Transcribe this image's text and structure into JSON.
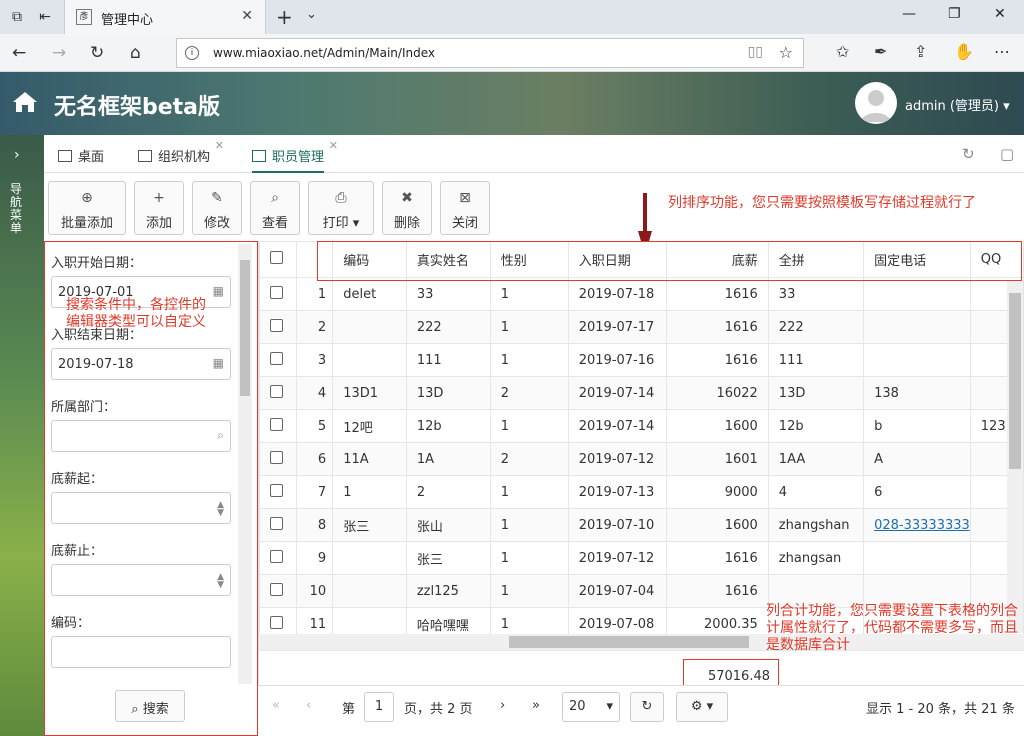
{
  "browser": {
    "tab_title": "管理中心",
    "tab_favicon_text": "彥",
    "url": "www.miaoxiao.net/Admin/Main/Index"
  },
  "header": {
    "brand": "无名框架beta版",
    "user": "admin (管理员)"
  },
  "side": {
    "vertical_text": "导航菜单"
  },
  "tabs": [
    {
      "label": "桌面"
    },
    {
      "label": "组织机构"
    },
    {
      "label": "职员管理"
    }
  ],
  "toolbar": [
    {
      "label": "批量添加",
      "icon": "plus-circle-icon",
      "glyph": "⊕"
    },
    {
      "label": "添加",
      "icon": "plus-icon",
      "glyph": "+"
    },
    {
      "label": "修改",
      "icon": "pencil-icon",
      "glyph": "✎"
    },
    {
      "label": "查看",
      "icon": "search-icon",
      "glyph": "⌕"
    },
    {
      "label": "打印",
      "icon": "print-icon",
      "glyph": "⎙"
    },
    {
      "label": "删除",
      "icon": "delete-icon",
      "glyph": "✖"
    },
    {
      "label": "关闭",
      "icon": "close-box-icon",
      "glyph": "⊠"
    }
  ],
  "notes": {
    "sort": "列排序功能，您只需要按照模板写存储过程就行了",
    "filter": "搜索条件中，各控件的编辑器类型可以自定义",
    "sum": "列合计功能，您只需要设置下表格的列合计属性就行了，代码都不需要多写，而且是数据库合计"
  },
  "filter": {
    "f1_label": "入职开始日期：",
    "f1_value": "2019-07-01",
    "f2_label": "入职结束日期：",
    "f2_value": "2019-07-18",
    "f3_label": "所属部门：",
    "f4_label": "底薪起：",
    "f5_label": "底薪止：",
    "f6_label": "编码：",
    "search_label": "搜索"
  },
  "grid": {
    "columns": [
      "编码",
      "真实姓名",
      "性别",
      "入职日期",
      "底薪",
      "全拼",
      "固定电话",
      "QQ"
    ],
    "rows": [
      [
        "1",
        "delet",
        "33",
        "1",
        "2019-07-18",
        "1616",
        "33",
        "",
        ""
      ],
      [
        "2",
        "",
        "222",
        "1",
        "2019-07-17",
        "1616",
        "222",
        "",
        ""
      ],
      [
        "3",
        "",
        "111",
        "1",
        "2019-07-16",
        "1616",
        "111",
        "",
        ""
      ],
      [
        "4",
        "13D1",
        "13D",
        "2",
        "2019-07-14",
        "16022",
        "13D",
        "138",
        ""
      ],
      [
        "5",
        "12吧",
        "12b",
        "1",
        "2019-07-14",
        "1600",
        "12b",
        "b",
        "123"
      ],
      [
        "6",
        "11A",
        "1A",
        "2",
        "2019-07-12",
        "1601",
        "1AA",
        "A",
        ""
      ],
      [
        "7",
        "1",
        "2",
        "1",
        "2019-07-13",
        "9000",
        "4",
        "6",
        ""
      ],
      [
        "8",
        "张三",
        "张山",
        "1",
        "2019-07-10",
        "1600",
        "zhangshan",
        "028-33333333",
        ""
      ],
      [
        "9",
        "",
        "张三",
        "1",
        "2019-07-12",
        "1616",
        "zhangsan",
        "",
        ""
      ],
      [
        "10",
        "",
        "zzl125",
        "1",
        "2019-07-04",
        "1616",
        "",
        "",
        ""
      ],
      [
        "11",
        "",
        "哈哈嘿嘿",
        "1",
        "2019-07-08",
        "2000.35",
        "",
        "",
        ""
      ]
    ],
    "sum": "57016.48"
  },
  "pager": {
    "page_prefix": "第",
    "page": "1",
    "page_suffix": "页，共 2 页",
    "page_size": "20",
    "summary": "显示 1 - 20 条，共 21 条"
  }
}
